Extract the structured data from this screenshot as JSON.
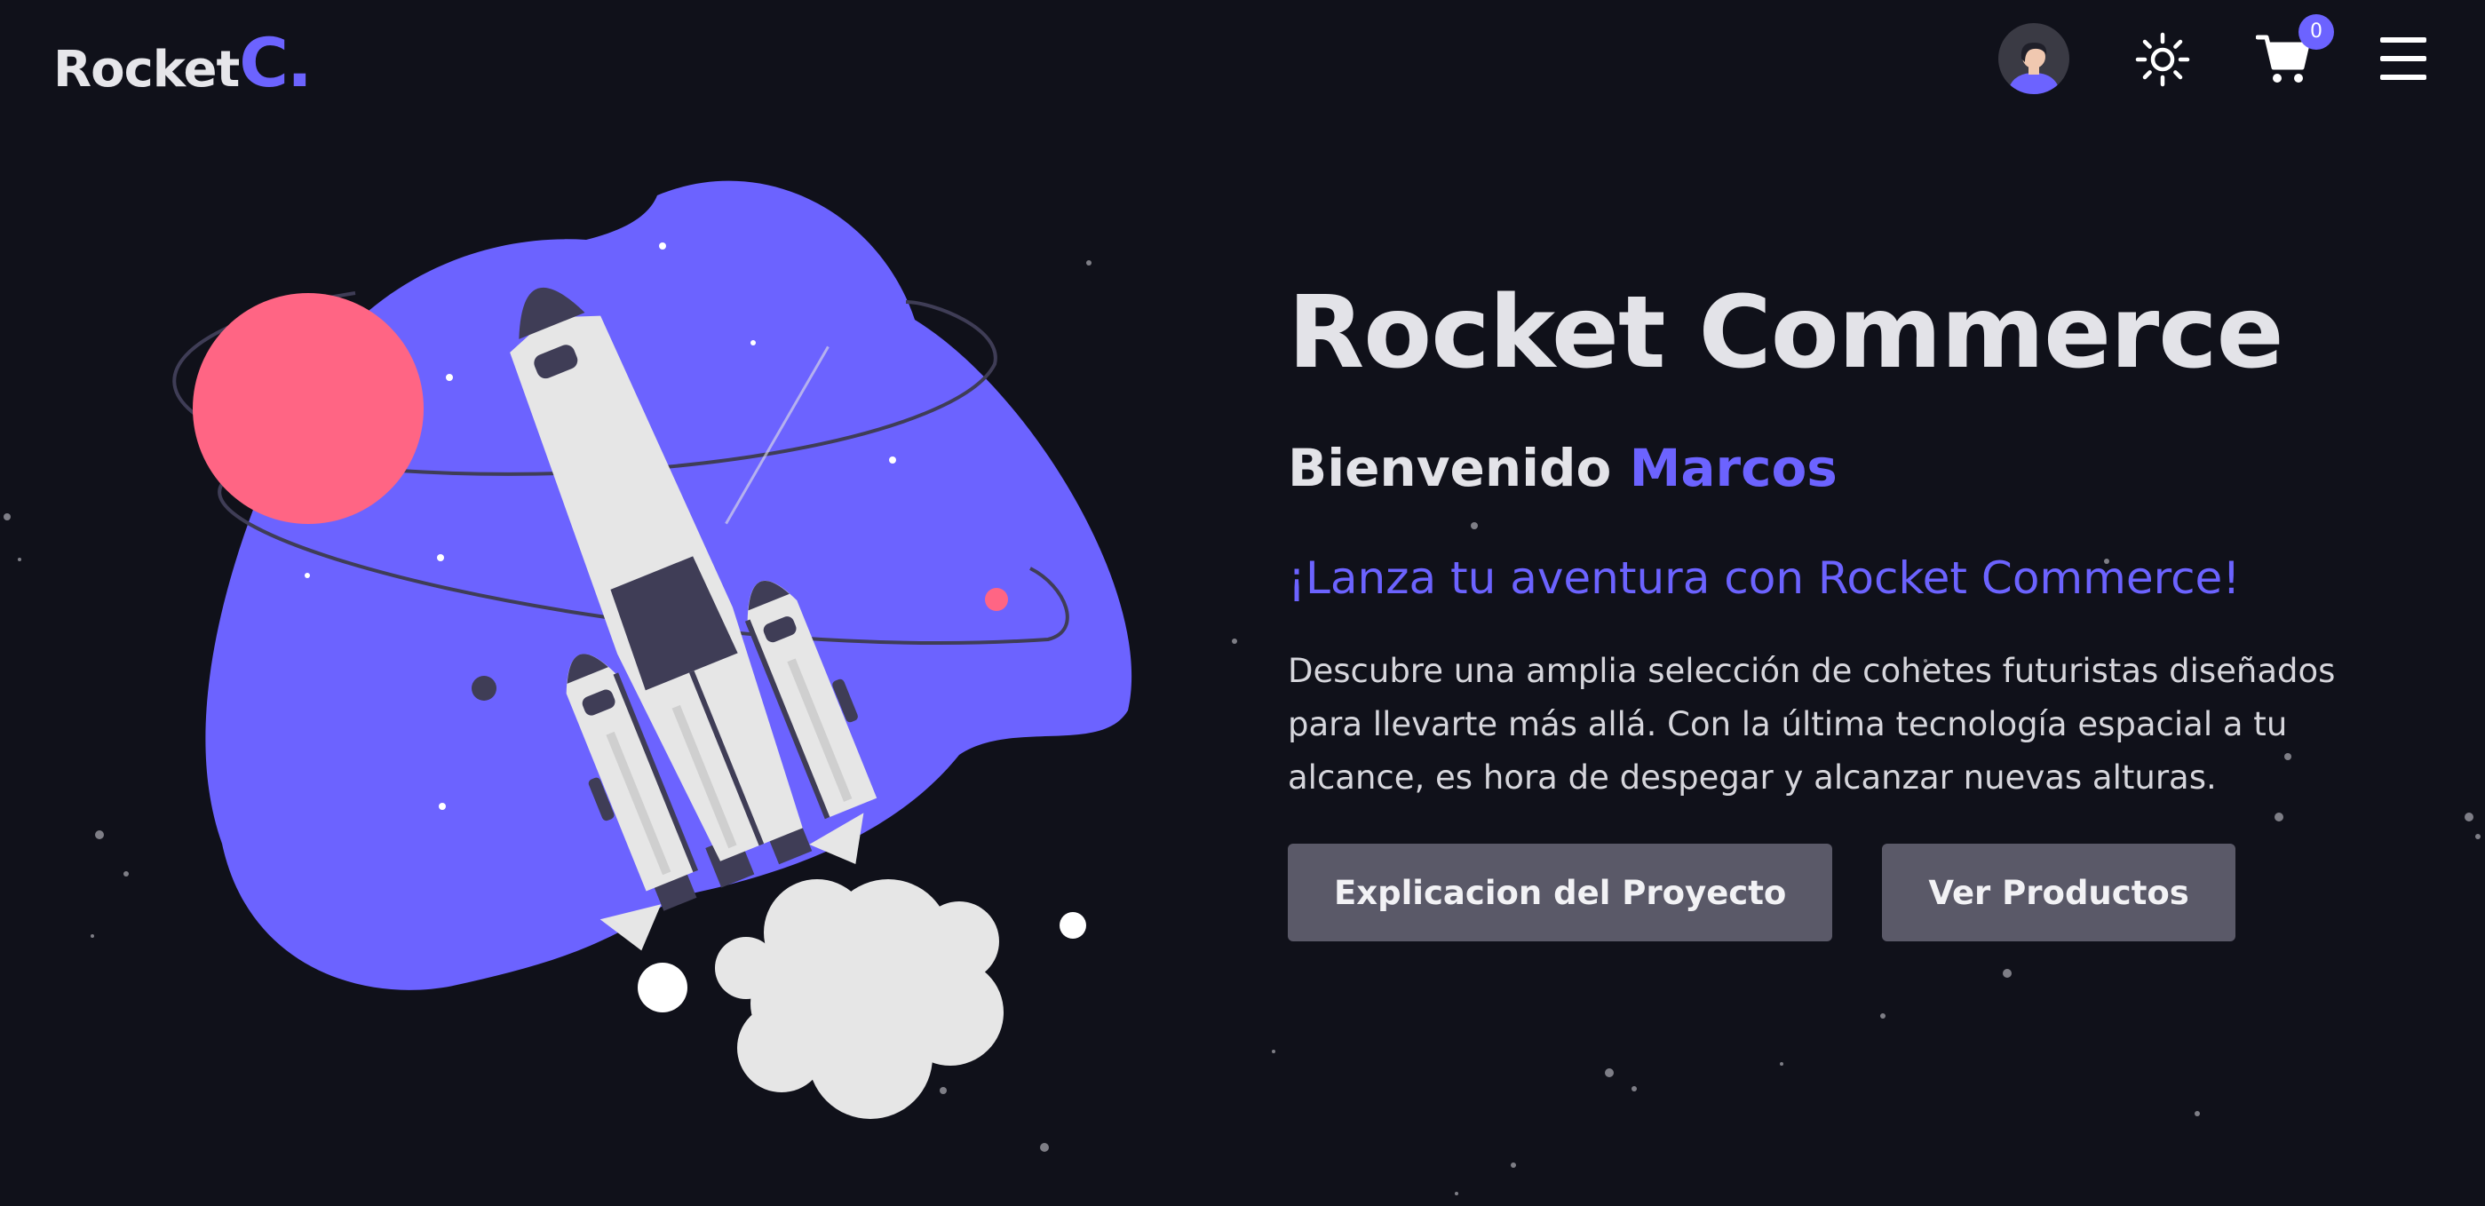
{
  "nav": {
    "logo_main": "Rocket",
    "logo_accent": "C.",
    "cart_count": "0",
    "icons": [
      "avatar",
      "sun-icon",
      "cart-icon",
      "menu-icon"
    ]
  },
  "hero": {
    "title": "Rocket Commerce",
    "welcome_prefix": "Bienvenido",
    "welcome_user": "Marcos",
    "tagline": "¡Lanza tu aventura con Rocket Commerce!",
    "description": "Descubre una amplia selección de cohetes futuristas diseñados para llevarte más allá. Con la última tecnología espacial a tu alcance, es hora de despegar y alcanzar nuevas alturas.",
    "buttons": {
      "project_label": "Explicacion del Proyecto",
      "products_label": "Ver Productos"
    }
  },
  "colors": {
    "background": "#10111a",
    "accent": "#6c63ff",
    "planet": "#ff6584",
    "button": "#5a5968",
    "text": "#e3e3e8"
  }
}
